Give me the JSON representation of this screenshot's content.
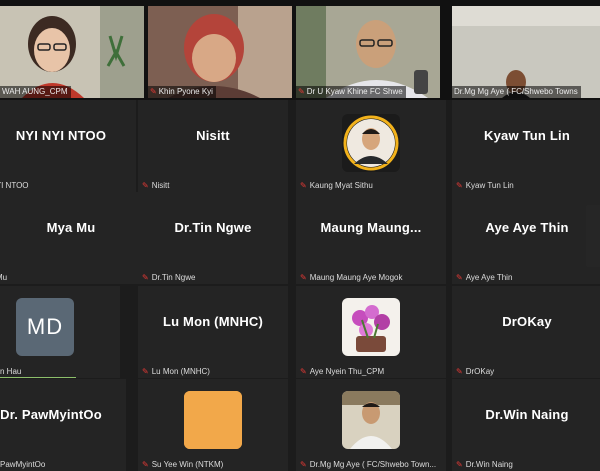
{
  "video_strip": [
    {
      "label": "WAH AUNG_CPM",
      "bg": "#b8b4a4"
    },
    {
      "label": "Khin Pyone Kyi",
      "bg": "#8d6a5a"
    },
    {
      "label": "Dr U Kyaw Khine FC Shwe",
      "bg": "#a7a392"
    },
    {
      "label": "Dr.Mg Mg Aye ( FC/Shwebo Towns",
      "bg": "#b9b8ae"
    }
  ],
  "grid": {
    "rows": [
      [
        {
          "name": "NYI NYI NTOO",
          "label": "NYI NTOO"
        },
        {
          "name": "Nisitt",
          "label": "Nisitt"
        },
        {
          "name": "",
          "label": "Kaung Myat Sithu",
          "avatar": "photo"
        },
        {
          "name": "Kyaw Tun Lin",
          "label": "Kyaw Tun Lin"
        }
      ],
      [
        {
          "name": "Mya Mu",
          "label": "Mu"
        },
        {
          "name": "Dr.Tin Ngwe",
          "label": "Dr.Tin Ngwe"
        },
        {
          "name": "Maung Maung...",
          "label": "Maung Maung Aye Mogok"
        },
        {
          "name": "Aye Aye Thin",
          "label": "Aye Aye Thin"
        }
      ],
      [
        {
          "name": "",
          "label": "n Hau",
          "avatar": "md",
          "avatar_text": "MD"
        },
        {
          "name": "Lu Mon (MNHC)",
          "label": "Lu Mon (MNHC)"
        },
        {
          "name": "",
          "label": "Aye Nyein Thu_CPM",
          "avatar": "flowers"
        },
        {
          "name": "DrOKay",
          "label": "DrOKay"
        }
      ],
      [
        {
          "name": "Dr. PawMyintOo",
          "label": "PawMyintOo"
        },
        {
          "name": "",
          "label": "Su Yee Win (NTKM)",
          "avatar": "orange"
        },
        {
          "name": "",
          "label": "Dr.Mg Mg Aye ( FC/Shwebo Town...",
          "avatar": "man"
        },
        {
          "name": "Dr.Win Naing",
          "label": "Dr.Win Naing"
        }
      ]
    ]
  },
  "icons": {
    "muted": "mic-muted-icon"
  },
  "colors": {
    "active_speaker": "#3ad35a",
    "muted": "#e53935"
  }
}
